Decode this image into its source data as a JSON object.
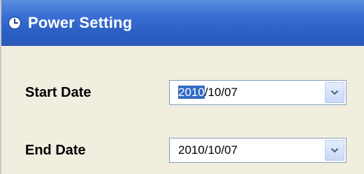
{
  "window": {
    "title": "Power Setting",
    "title_icon": "clock-icon",
    "accent_color": "#2b5fc4"
  },
  "start": {
    "label": "Start Date",
    "value_selected": "2010",
    "value_rest": "/10/07",
    "dropdown_icon": "chevron-down-icon"
  },
  "end": {
    "label": "End Date",
    "value": "2010/10/07",
    "dropdown_icon": "chevron-down-icon"
  }
}
